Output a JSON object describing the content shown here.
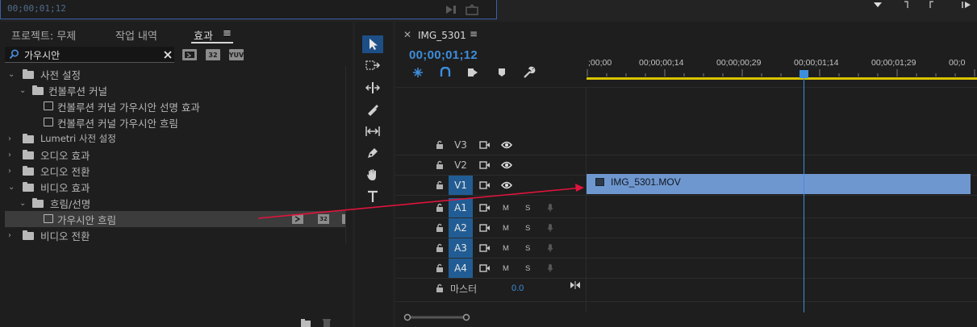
{
  "top": {
    "timecode": "00;00;01;12"
  },
  "effects_panel": {
    "tabs": [
      {
        "label": "프로젝트: 무제"
      },
      {
        "label": "작업 내역"
      },
      {
        "label": "효과"
      }
    ],
    "tab_menu_glyph": "≡",
    "search": {
      "value": "가우시안"
    },
    "filter_badges": [
      "32",
      "YUV"
    ],
    "tree": [
      {
        "label": "사전 설정",
        "kind": "preset-folder",
        "expanded": true
      },
      {
        "label": "컨볼루션 커널",
        "kind": "preset-folder",
        "expanded": true
      },
      {
        "label": "컨볼루션 커널 가우시안 선명 효과",
        "kind": "preset"
      },
      {
        "label": "컨볼루션 커널 가우시안 흐림",
        "kind": "preset"
      },
      {
        "label": "Lumetri 사전 설정",
        "kind": "preset-folder",
        "expanded": false
      },
      {
        "label": "오디오 효과",
        "kind": "folder",
        "expanded": false
      },
      {
        "label": "오디오 전환",
        "kind": "folder",
        "expanded": false
      },
      {
        "label": "비디오 효과",
        "kind": "folder",
        "expanded": true
      },
      {
        "label": "흐림/선명",
        "kind": "folder",
        "expanded": true
      },
      {
        "label": "가우시안 흐림",
        "kind": "effect",
        "selected": true
      },
      {
        "label": "비디오 전환",
        "kind": "folder",
        "expanded": false
      }
    ],
    "row_badges": [
      "32"
    ]
  },
  "tools": [
    "selection",
    "track-select-forward",
    "ripple-edit",
    "razor",
    "slip",
    "pen",
    "hand",
    "type"
  ],
  "timeline": {
    "sequence_name": "IMG_5301",
    "menu_glyph": "≡",
    "timecode": "00;00;01;12",
    "ruler_ticks": [
      ";00;00",
      "00;00;00;14",
      "00;00;00;29",
      "00;00;01;14",
      "00;00;01;29",
      "00;0"
    ],
    "video_tracks": [
      {
        "label": "V3",
        "on": false
      },
      {
        "label": "V2",
        "on": false
      },
      {
        "label": "V1",
        "on": true
      }
    ],
    "audio_tracks": [
      {
        "label": "A1",
        "m": "M",
        "s": "S"
      },
      {
        "label": "A2",
        "m": "M",
        "s": "S"
      },
      {
        "label": "A3",
        "m": "M",
        "s": "S"
      },
      {
        "label": "A4",
        "m": "M",
        "s": "S"
      }
    ],
    "clip": {
      "name": "IMG_5301.MOV",
      "color": "#6f97cf"
    },
    "master": {
      "label": "마스터",
      "value": "0.0"
    },
    "playhead_color": "#3e8ee0"
  },
  "colors": {
    "accent": "#3d8edb",
    "work_area": "#d8c400",
    "annotation_arrow": "#e0143c"
  }
}
